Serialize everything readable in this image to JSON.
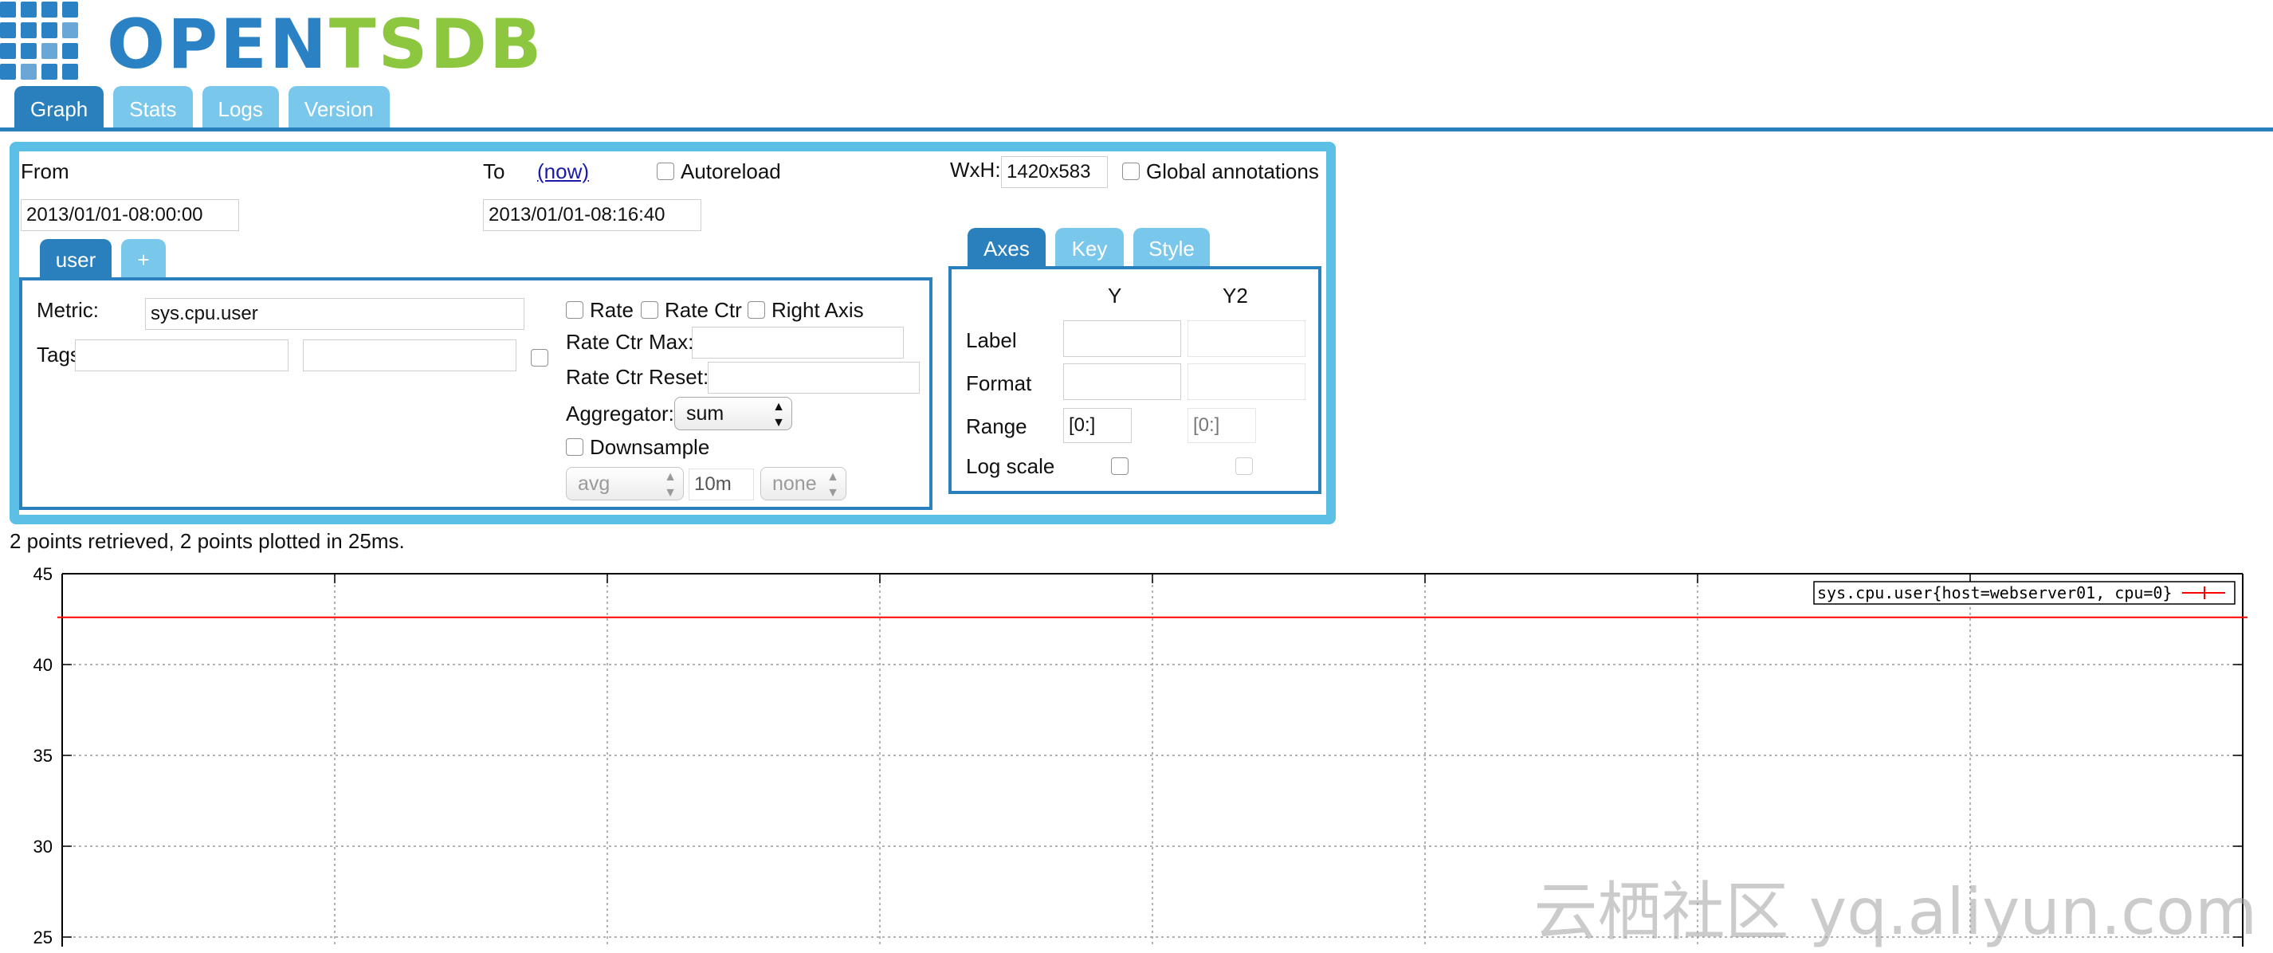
{
  "logo": {
    "open": "OPEN",
    "tsdb": "TSDB"
  },
  "main_tabs": [
    {
      "label": "Graph",
      "active": true
    },
    {
      "label": "Stats",
      "active": false
    },
    {
      "label": "Logs",
      "active": false
    },
    {
      "label": "Version",
      "active": false
    }
  ],
  "time": {
    "from_label": "From",
    "from_value": "2013/01/01-08:00:00",
    "to_label": "To",
    "now_link": "(now)",
    "to_value": "2013/01/01-08:16:40",
    "autoreload_label": "Autoreload"
  },
  "size": {
    "wxh_label": "WxH:",
    "wxh_value": "1420x583",
    "global_annotations_label": "Global annotations"
  },
  "metric_tabs": [
    {
      "label": "user",
      "active": true
    },
    {
      "label": "+",
      "active": false
    }
  ],
  "metric": {
    "metric_label": "Metric:",
    "metric_value": "sys.cpu.user",
    "tags_label": "Tags",
    "tag_key": "",
    "tag_value": "",
    "rate_label": "Rate",
    "rate_ctr_label": "Rate Ctr",
    "right_axis_label": "Right Axis",
    "rate_ctr_max_label": "Rate Ctr Max:",
    "rate_ctr_reset_label": "Rate Ctr Reset:",
    "aggregator_label": "Aggregator:",
    "aggregator_value": "sum",
    "downsample_label": "Downsample",
    "downsample_func": "avg",
    "downsample_interval": "10m",
    "downsample_fill": "none"
  },
  "axes_tabs": [
    {
      "label": "Axes",
      "active": true
    },
    {
      "label": "Key",
      "active": false
    },
    {
      "label": "Style",
      "active": false
    }
  ],
  "axes": {
    "y_header": "Y",
    "y2_header": "Y2",
    "label_row": "Label",
    "format_row": "Format",
    "range_row": "Range",
    "log_scale_row": "Log scale",
    "y_range": "[0:]",
    "y2_range": "[0:]"
  },
  "status_text": "2 points retrieved, 2 points plotted in 25ms.",
  "chart_data": {
    "type": "line",
    "yticks": [
      45,
      40,
      35,
      30,
      25
    ],
    "ylim": [
      24,
      45
    ],
    "series": [
      {
        "name": "sys.cpu.user{host=webserver01, cpu=0}",
        "color": "#ff0000",
        "points": [
          [
            0,
            42.6
          ],
          [
            1,
            42.6
          ]
        ]
      }
    ]
  },
  "watermark": "云栖社区 yq.aliyun.com"
}
